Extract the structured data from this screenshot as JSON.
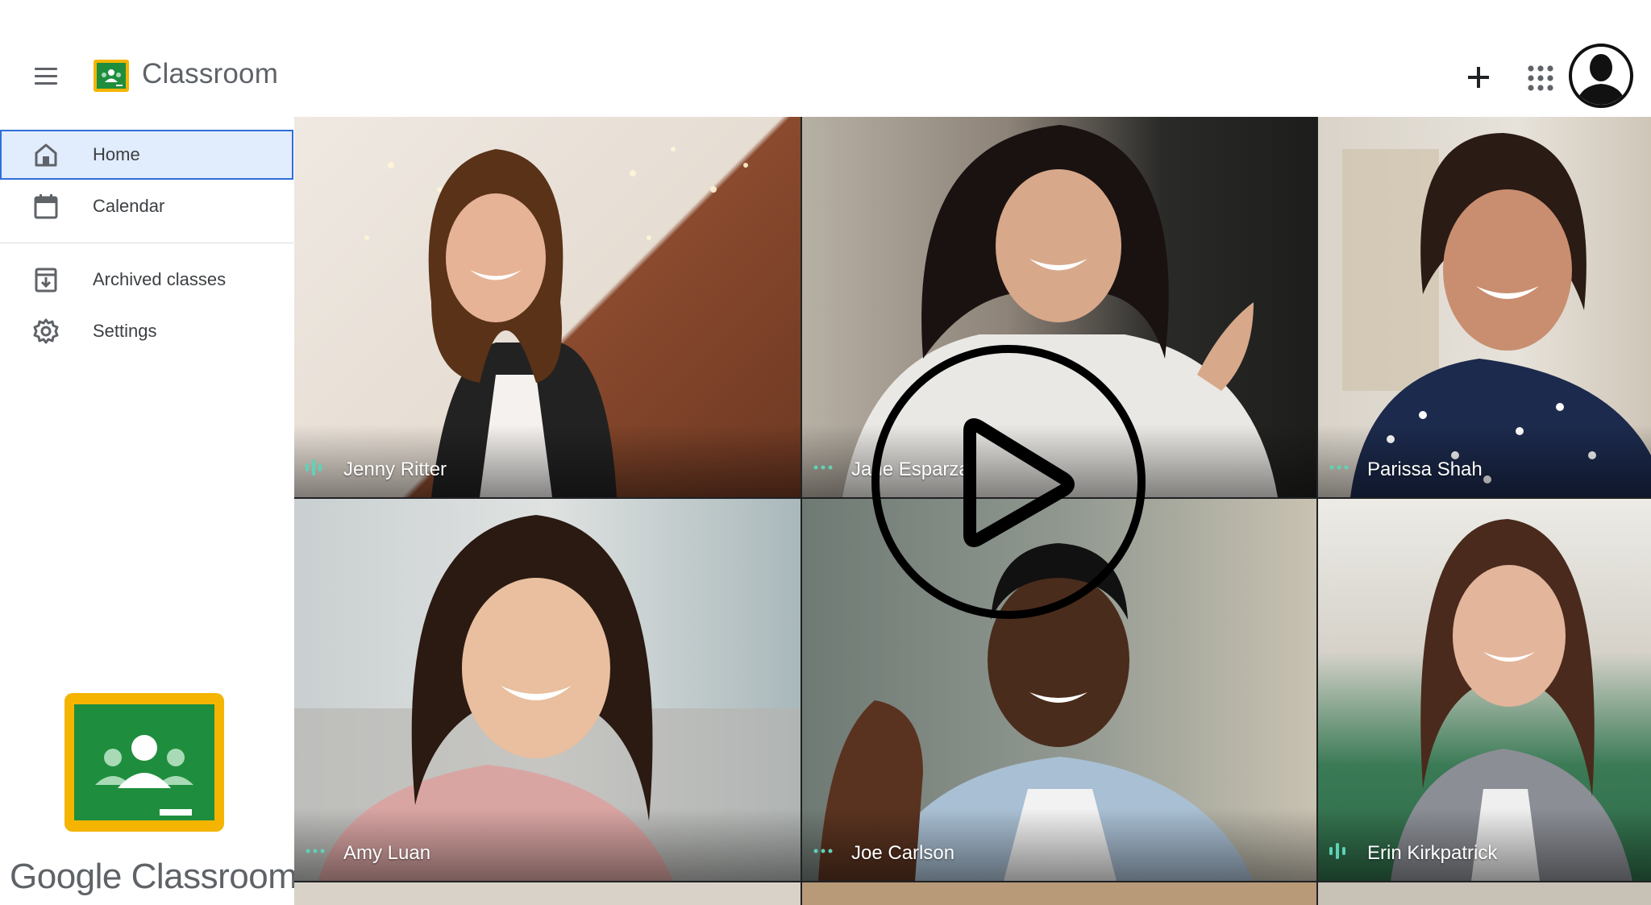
{
  "header": {
    "app_title": "Classroom",
    "brand_primary": "#1e8e3e",
    "brand_accent": "#f4b400"
  },
  "sidebar": {
    "items": [
      {
        "label": "Home",
        "icon": "home-icon",
        "active": true
      },
      {
        "label": "Calendar",
        "icon": "calendar-icon",
        "active": false
      },
      {
        "label": "Archived classes",
        "icon": "archive-icon",
        "active": false
      },
      {
        "label": "Settings",
        "icon": "gear-icon",
        "active": false
      }
    ],
    "brand_text_google": "Google",
    "brand_text_classroom": "Classroom"
  },
  "participants": [
    {
      "name": "Jenny Ritter",
      "status": "speaking"
    },
    {
      "name": "Jane Esparza",
      "status": "idle"
    },
    {
      "name": "Parissa Shah",
      "status": "idle"
    },
    {
      "name": "Amy Luan",
      "status": "idle"
    },
    {
      "name": "Joe Carlson",
      "status": "idle"
    },
    {
      "name": "Erin Kirkpatrick",
      "status": "speaking"
    }
  ],
  "colors": {
    "active_nav_bg": "#e1ecfc",
    "active_nav_border": "#2f6fdb",
    "status_teal": "#5fd2b5"
  }
}
